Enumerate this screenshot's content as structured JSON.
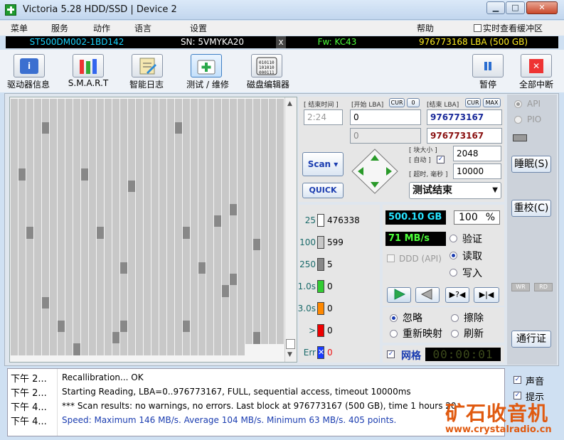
{
  "window": {
    "title": "Victoria 5.28 HDD/SSD | Device 2",
    "min": "▁",
    "max": "□",
    "close": "✕"
  },
  "menu": {
    "items": [
      "菜单",
      "服务",
      "动作",
      "语言",
      "设置"
    ],
    "help": "帮助",
    "cache_check": "实时查看缓冲区"
  },
  "status": {
    "model": "ST500DM002-1BD142",
    "sn": "SN: 5VMYKA20",
    "x": "x",
    "fw": "Fw: KC43",
    "lba": "976773168 LBA (500 GB)"
  },
  "toolbar": {
    "drive_info": "驱动器信息",
    "smart": "S.M.A.R.T",
    "smart_log": "智能日志",
    "test_repair": "测试 / 维修",
    "disk_editor": "磁盘编辑器",
    "pause": "暂停",
    "abort_all": "全部中断"
  },
  "scan": {
    "end_time_label": "[ 结束时间 ]",
    "start_lba_label": "[开始 LBA]",
    "cur": "CUR",
    "zero": "0",
    "end_lba_label": "[结束 LBA]",
    "max": "MAX",
    "time": "2:24",
    "start_lba": "0",
    "end_lba": "976773167",
    "start_lba2": "0",
    "end_lba2": "976773167",
    "scan_btn": "Scan",
    "quick_btn": "QUICK",
    "block_size_label": "[ 块大小 ]",
    "auto_label": "[ 自动 ]",
    "block_size": "2048",
    "timeout_label": "[ 超时, 毫秒 ]",
    "timeout": "10000",
    "mode": "测试结束"
  },
  "legend": [
    {
      "t": "25",
      "v": "476338",
      "c": "#ffffff"
    },
    {
      "t": "100",
      "v": "599",
      "c": "#c8c8c8"
    },
    {
      "t": "250",
      "v": "5",
      "c": "#888888"
    },
    {
      "t": "1.0s",
      "v": "0",
      "c": "#33cc33"
    },
    {
      "t": "3.0s",
      "v": "0",
      "c": "#ff8800"
    },
    {
      "t": ">",
      "v": "0",
      "c": "#ee0000"
    },
    {
      "t": "Err",
      "v": "0",
      "c": "#1a3cff"
    }
  ],
  "stats": {
    "size": "500.10 GB",
    "percent": "100",
    "percent_sign": "%",
    "speed": "71 MB/s",
    "ddd": "DDD (API)",
    "verify": "验证",
    "read": "读取",
    "write": "写入",
    "ignore": "忽略",
    "erase": "擦除",
    "remap": "重新映射",
    "refresh": "刷新",
    "grid": "网格",
    "elapsed": "00:00:01"
  },
  "side": {
    "api": "API",
    "pio": "PIO",
    "sleep": "睡眠(S)",
    "recal": "重校(C)",
    "wr": "WR",
    "rd": "RD",
    "passport": "通行证",
    "sound": "声音",
    "hints": "提示"
  },
  "log": [
    {
      "time": "下午 2...",
      "msg": "Recallibration... OK",
      "color": "#000"
    },
    {
      "time": "下午 2...",
      "msg": "Starting Reading, LBA=0..976773167, FULL, sequential access, timeout 10000ms",
      "color": "#000"
    },
    {
      "time": "下午 4...",
      "msg": "*** Scan results: no warnings, no errors. Last block at 976773167 (500 GB), time 1 hours 20 ",
      "color": "#000"
    },
    {
      "time": "下午 4...",
      "msg": "Speed: Maximum 146 MB/s. Average 104 MB/s. Minimum 63 MB/s. 405 points.",
      "color": "#1a3cb0"
    }
  ],
  "watermark": {
    "cn": "矿石收音机",
    "url": "www.crystalradio.cn"
  },
  "colors": {
    "accent": "#1a3cb0",
    "status_bg": "#000000",
    "grid_light": "#c8c8c8",
    "grid_dark": "#888888"
  }
}
